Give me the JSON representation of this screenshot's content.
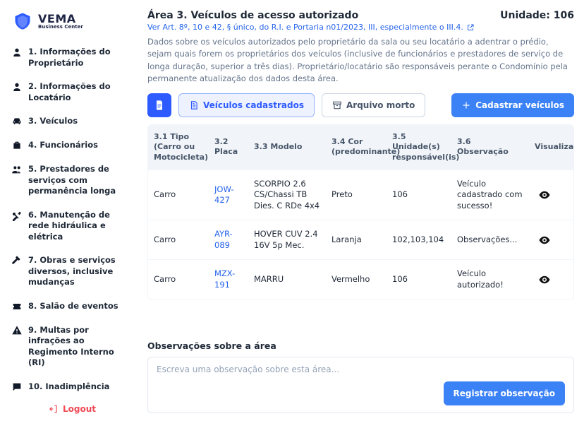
{
  "brand": {
    "name": "VEMA",
    "tagline": "Business Center"
  },
  "sidebar": {
    "items": [
      {
        "icon": "user",
        "label": "1. Informações do Proprietário"
      },
      {
        "icon": "user",
        "label": "2. Informações do Locatário"
      },
      {
        "icon": "car",
        "label": "3. Veículos"
      },
      {
        "icon": "briefcase",
        "label": "4. Funcionários"
      },
      {
        "icon": "group",
        "label": "5. Prestadores de serviços com permanência longa"
      },
      {
        "icon": "tools",
        "label": "6. Manutenção de rede hidráulica e elétrica"
      },
      {
        "icon": "hammer",
        "label": "7. Obras e serviços diversos, inclusive mudanças"
      },
      {
        "icon": "ticket",
        "label": "8. Salão de eventos"
      },
      {
        "icon": "warning",
        "label": "9. Multas por infrações ao Regimento Interno (RI)"
      },
      {
        "icon": "chat",
        "label": "10. Inadimplência"
      }
    ],
    "logout_label": "Logout"
  },
  "page": {
    "title": "Área 3. Veículos de acesso autorizado",
    "unit_label": "Unidade: 106",
    "reference": "Ver Art. 8º, 10 e 42, § único, do R.I. e Portaria n01/2023, III, especialmente o III.4.",
    "description": "Dados sobre os veículos autorizados pelo proprietário da sala ou seu locatário a adentrar o prédio, sejam quais forem os proprietários dos veículos (inclusive de funcionários e prestadores de serviço de longa duração, superior a três dias). Proprietário/locatário são responsáveis perante o Condomínio pela permanente atualização dos dados desta área."
  },
  "toolbar": {
    "tab_registered": "Veículos cadastrados",
    "tab_archived": "Arquivo morto",
    "add_button": "Cadastrar veículos"
  },
  "table": {
    "headers": {
      "tipo": "3.1 Tipo (Carro ou Motocicleta)",
      "placa": "3.2 Placa",
      "modelo": "3.3 Modelo",
      "cor": "3.4 Cor (predominante)",
      "unidade": "3.5 Unidade(s) responsável(is)",
      "obs": "3.6 Observação",
      "view": "Visualizar"
    },
    "rows": [
      {
        "tipo": "Carro",
        "placa": "JOW-427",
        "modelo": "SCORPIO 2.6 CS/Chassi TB Dies. C RDe 4x4",
        "cor": "Preto",
        "unidade": "106",
        "obs": "Veículo cadastrado com sucesso!"
      },
      {
        "tipo": "Carro",
        "placa": "AYR-089",
        "modelo": "HOVER CUV 2.4 16V 5p Mec.",
        "cor": "Laranja",
        "unidade": "102,103,104",
        "obs": "Observações..."
      },
      {
        "tipo": "Carro",
        "placa": "MZX-191",
        "modelo": "MARRU",
        "cor": "Vermelho",
        "unidade": "106",
        "obs": "Veículo autorizado!"
      }
    ]
  },
  "observations": {
    "title": "Observações sobre a área",
    "placeholder": "Escreva uma observação sobre esta área...",
    "submit": "Registrar observação"
  }
}
